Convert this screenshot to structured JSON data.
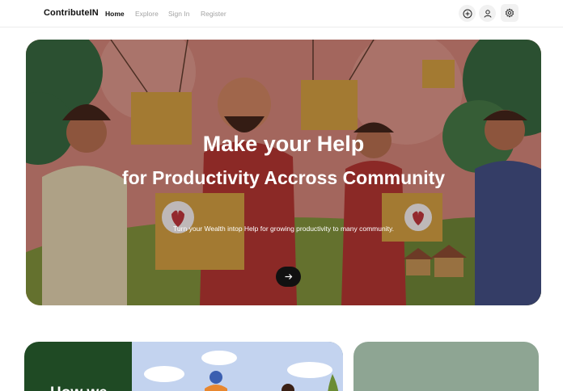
{
  "navbar": {
    "brand": "ContributeIN",
    "links": [
      {
        "label": "Home",
        "active": true
      },
      {
        "label": "Explore",
        "active": false
      },
      {
        "label": "Sign In",
        "active": false
      },
      {
        "label": "Register",
        "active": false
      }
    ],
    "icons": [
      "plus-circle-icon",
      "user-icon",
      "gear-icon"
    ]
  },
  "hero": {
    "title_line1": "Make your Help",
    "title_line2": "for Productivity Accross Community",
    "subtitle": "Turn your Wealth intop Help for growing productivity to many community.",
    "arrow_icon": "arrow-right-icon"
  },
  "how_card": {
    "title": "How we"
  },
  "colors": {
    "hero_bg": "#c97a6f",
    "how_card_bg": "#1f4a24",
    "side_card_bg": "#8ea593",
    "arrow_button_bg": "#111111"
  }
}
